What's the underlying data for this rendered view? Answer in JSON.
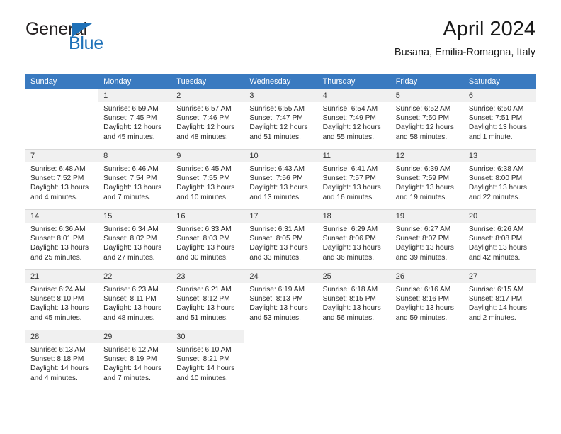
{
  "logo": {
    "primary_text": "General",
    "secondary_text": "Blue",
    "primary_color": "#231f20",
    "accent_color": "#1f71b8"
  },
  "header": {
    "month_title": "April 2024",
    "location": "Busana, Emilia-Romagna, Italy"
  },
  "calendar": {
    "header_color": "#3a7ac0",
    "daynum_band_color": "#f0f0f0",
    "weekday_headers": [
      "Sunday",
      "Monday",
      "Tuesday",
      "Wednesday",
      "Thursday",
      "Friday",
      "Saturday"
    ],
    "weeks": [
      [
        {
          "day": "",
          "lines": []
        },
        {
          "day": "1",
          "lines": [
            "Sunrise: 6:59 AM",
            "Sunset: 7:45 PM",
            "Daylight: 12 hours",
            "and 45 minutes."
          ]
        },
        {
          "day": "2",
          "lines": [
            "Sunrise: 6:57 AM",
            "Sunset: 7:46 PM",
            "Daylight: 12 hours",
            "and 48 minutes."
          ]
        },
        {
          "day": "3",
          "lines": [
            "Sunrise: 6:55 AM",
            "Sunset: 7:47 PM",
            "Daylight: 12 hours",
            "and 51 minutes."
          ]
        },
        {
          "day": "4",
          "lines": [
            "Sunrise: 6:54 AM",
            "Sunset: 7:49 PM",
            "Daylight: 12 hours",
            "and 55 minutes."
          ]
        },
        {
          "day": "5",
          "lines": [
            "Sunrise: 6:52 AM",
            "Sunset: 7:50 PM",
            "Daylight: 12 hours",
            "and 58 minutes."
          ]
        },
        {
          "day": "6",
          "lines": [
            "Sunrise: 6:50 AM",
            "Sunset: 7:51 PM",
            "Daylight: 13 hours",
            "and 1 minute."
          ]
        }
      ],
      [
        {
          "day": "7",
          "lines": [
            "Sunrise: 6:48 AM",
            "Sunset: 7:52 PM",
            "Daylight: 13 hours",
            "and 4 minutes."
          ]
        },
        {
          "day": "8",
          "lines": [
            "Sunrise: 6:46 AM",
            "Sunset: 7:54 PM",
            "Daylight: 13 hours",
            "and 7 minutes."
          ]
        },
        {
          "day": "9",
          "lines": [
            "Sunrise: 6:45 AM",
            "Sunset: 7:55 PM",
            "Daylight: 13 hours",
            "and 10 minutes."
          ]
        },
        {
          "day": "10",
          "lines": [
            "Sunrise: 6:43 AM",
            "Sunset: 7:56 PM",
            "Daylight: 13 hours",
            "and 13 minutes."
          ]
        },
        {
          "day": "11",
          "lines": [
            "Sunrise: 6:41 AM",
            "Sunset: 7:57 PM",
            "Daylight: 13 hours",
            "and 16 minutes."
          ]
        },
        {
          "day": "12",
          "lines": [
            "Sunrise: 6:39 AM",
            "Sunset: 7:59 PM",
            "Daylight: 13 hours",
            "and 19 minutes."
          ]
        },
        {
          "day": "13",
          "lines": [
            "Sunrise: 6:38 AM",
            "Sunset: 8:00 PM",
            "Daylight: 13 hours",
            "and 22 minutes."
          ]
        }
      ],
      [
        {
          "day": "14",
          "lines": [
            "Sunrise: 6:36 AM",
            "Sunset: 8:01 PM",
            "Daylight: 13 hours",
            "and 25 minutes."
          ]
        },
        {
          "day": "15",
          "lines": [
            "Sunrise: 6:34 AM",
            "Sunset: 8:02 PM",
            "Daylight: 13 hours",
            "and 27 minutes."
          ]
        },
        {
          "day": "16",
          "lines": [
            "Sunrise: 6:33 AM",
            "Sunset: 8:03 PM",
            "Daylight: 13 hours",
            "and 30 minutes."
          ]
        },
        {
          "day": "17",
          "lines": [
            "Sunrise: 6:31 AM",
            "Sunset: 8:05 PM",
            "Daylight: 13 hours",
            "and 33 minutes."
          ]
        },
        {
          "day": "18",
          "lines": [
            "Sunrise: 6:29 AM",
            "Sunset: 8:06 PM",
            "Daylight: 13 hours",
            "and 36 minutes."
          ]
        },
        {
          "day": "19",
          "lines": [
            "Sunrise: 6:27 AM",
            "Sunset: 8:07 PM",
            "Daylight: 13 hours",
            "and 39 minutes."
          ]
        },
        {
          "day": "20",
          "lines": [
            "Sunrise: 6:26 AM",
            "Sunset: 8:08 PM",
            "Daylight: 13 hours",
            "and 42 minutes."
          ]
        }
      ],
      [
        {
          "day": "21",
          "lines": [
            "Sunrise: 6:24 AM",
            "Sunset: 8:10 PM",
            "Daylight: 13 hours",
            "and 45 minutes."
          ]
        },
        {
          "day": "22",
          "lines": [
            "Sunrise: 6:23 AM",
            "Sunset: 8:11 PM",
            "Daylight: 13 hours",
            "and 48 minutes."
          ]
        },
        {
          "day": "23",
          "lines": [
            "Sunrise: 6:21 AM",
            "Sunset: 8:12 PM",
            "Daylight: 13 hours",
            "and 51 minutes."
          ]
        },
        {
          "day": "24",
          "lines": [
            "Sunrise: 6:19 AM",
            "Sunset: 8:13 PM",
            "Daylight: 13 hours",
            "and 53 minutes."
          ]
        },
        {
          "day": "25",
          "lines": [
            "Sunrise: 6:18 AM",
            "Sunset: 8:15 PM",
            "Daylight: 13 hours",
            "and 56 minutes."
          ]
        },
        {
          "day": "26",
          "lines": [
            "Sunrise: 6:16 AM",
            "Sunset: 8:16 PM",
            "Daylight: 13 hours",
            "and 59 minutes."
          ]
        },
        {
          "day": "27",
          "lines": [
            "Sunrise: 6:15 AM",
            "Sunset: 8:17 PM",
            "Daylight: 14 hours",
            "and 2 minutes."
          ]
        }
      ],
      [
        {
          "day": "28",
          "lines": [
            "Sunrise: 6:13 AM",
            "Sunset: 8:18 PM",
            "Daylight: 14 hours",
            "and 4 minutes."
          ]
        },
        {
          "day": "29",
          "lines": [
            "Sunrise: 6:12 AM",
            "Sunset: 8:19 PM",
            "Daylight: 14 hours",
            "and 7 minutes."
          ]
        },
        {
          "day": "30",
          "lines": [
            "Sunrise: 6:10 AM",
            "Sunset: 8:21 PM",
            "Daylight: 14 hours",
            "and 10 minutes."
          ]
        },
        {
          "day": "",
          "lines": []
        },
        {
          "day": "",
          "lines": []
        },
        {
          "day": "",
          "lines": []
        },
        {
          "day": "",
          "lines": []
        }
      ]
    ]
  }
}
